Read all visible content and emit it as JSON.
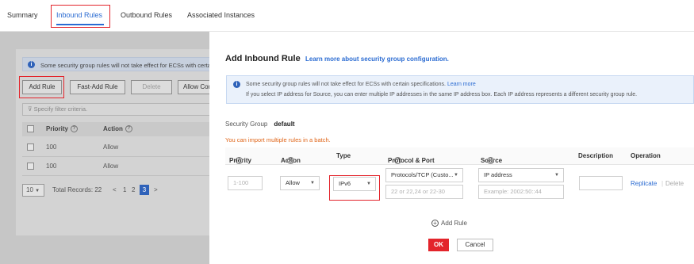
{
  "tabs": {
    "summary": "Summary",
    "inbound": "Inbound Rules",
    "outbound": "Outbound Rules",
    "associated": "Associated Instances"
  },
  "left_panel": {
    "notice": "Some security group rules will not take effect for ECSs with certain",
    "buttons": {
      "add_rule": "Add Rule",
      "fast_add_rule": "Fast-Add Rule",
      "delete": "Delete",
      "allow_common": "Allow Com"
    },
    "filter_placeholder": "Specify filter criteria.",
    "table": {
      "headers": [
        "Priority",
        "Action"
      ],
      "rows": [
        {
          "priority": "100",
          "action": "Allow"
        },
        {
          "priority": "100",
          "action": "Allow"
        }
      ]
    },
    "pager": {
      "page_size": "10",
      "total": "Total Records: 22",
      "prev": "<",
      "pages": [
        "1",
        "2",
        "3"
      ],
      "current": "3",
      "next": ">"
    }
  },
  "modal": {
    "title": "Add Inbound Rule",
    "learn_more": "Learn more about security group configuration.",
    "notice_line1": "Some security group rules will not take effect for ECSs with certain specifications.",
    "notice_line1_link": "Learn more",
    "notice_line2": "If you select IP address for Source, you can enter multiple IP addresses in the same IP address box. Each IP address represents a different security group rule.",
    "security_group_label": "Security Group",
    "security_group_value": "default",
    "import_text": "You can import multiple rules in a batch.",
    "table": {
      "headers": {
        "priority": "Priority",
        "action": "Action",
        "type": "Type",
        "protocol_port": "Protocol & Port",
        "source": "Source",
        "description": "Description",
        "operation": "Operation"
      },
      "row": {
        "priority_placeholder": "1-100",
        "action": "Allow",
        "type": "IPv6",
        "protocol": "Protocols/TCP (Custo...",
        "port_placeholder": "22 or 22,24 or 22-30",
        "source_type": "IP address",
        "source_placeholder": "Example: 2002:50::44",
        "description": "",
        "replicate": "Replicate",
        "separator": "|",
        "delete": "Delete"
      }
    },
    "add_rule": "Add Rule",
    "ok": "OK",
    "cancel": "Cancel"
  },
  "colors": {
    "accent_blue": "#2a6bd2",
    "highlight_red": "#e3242b",
    "warning_orange": "#e0661a"
  }
}
